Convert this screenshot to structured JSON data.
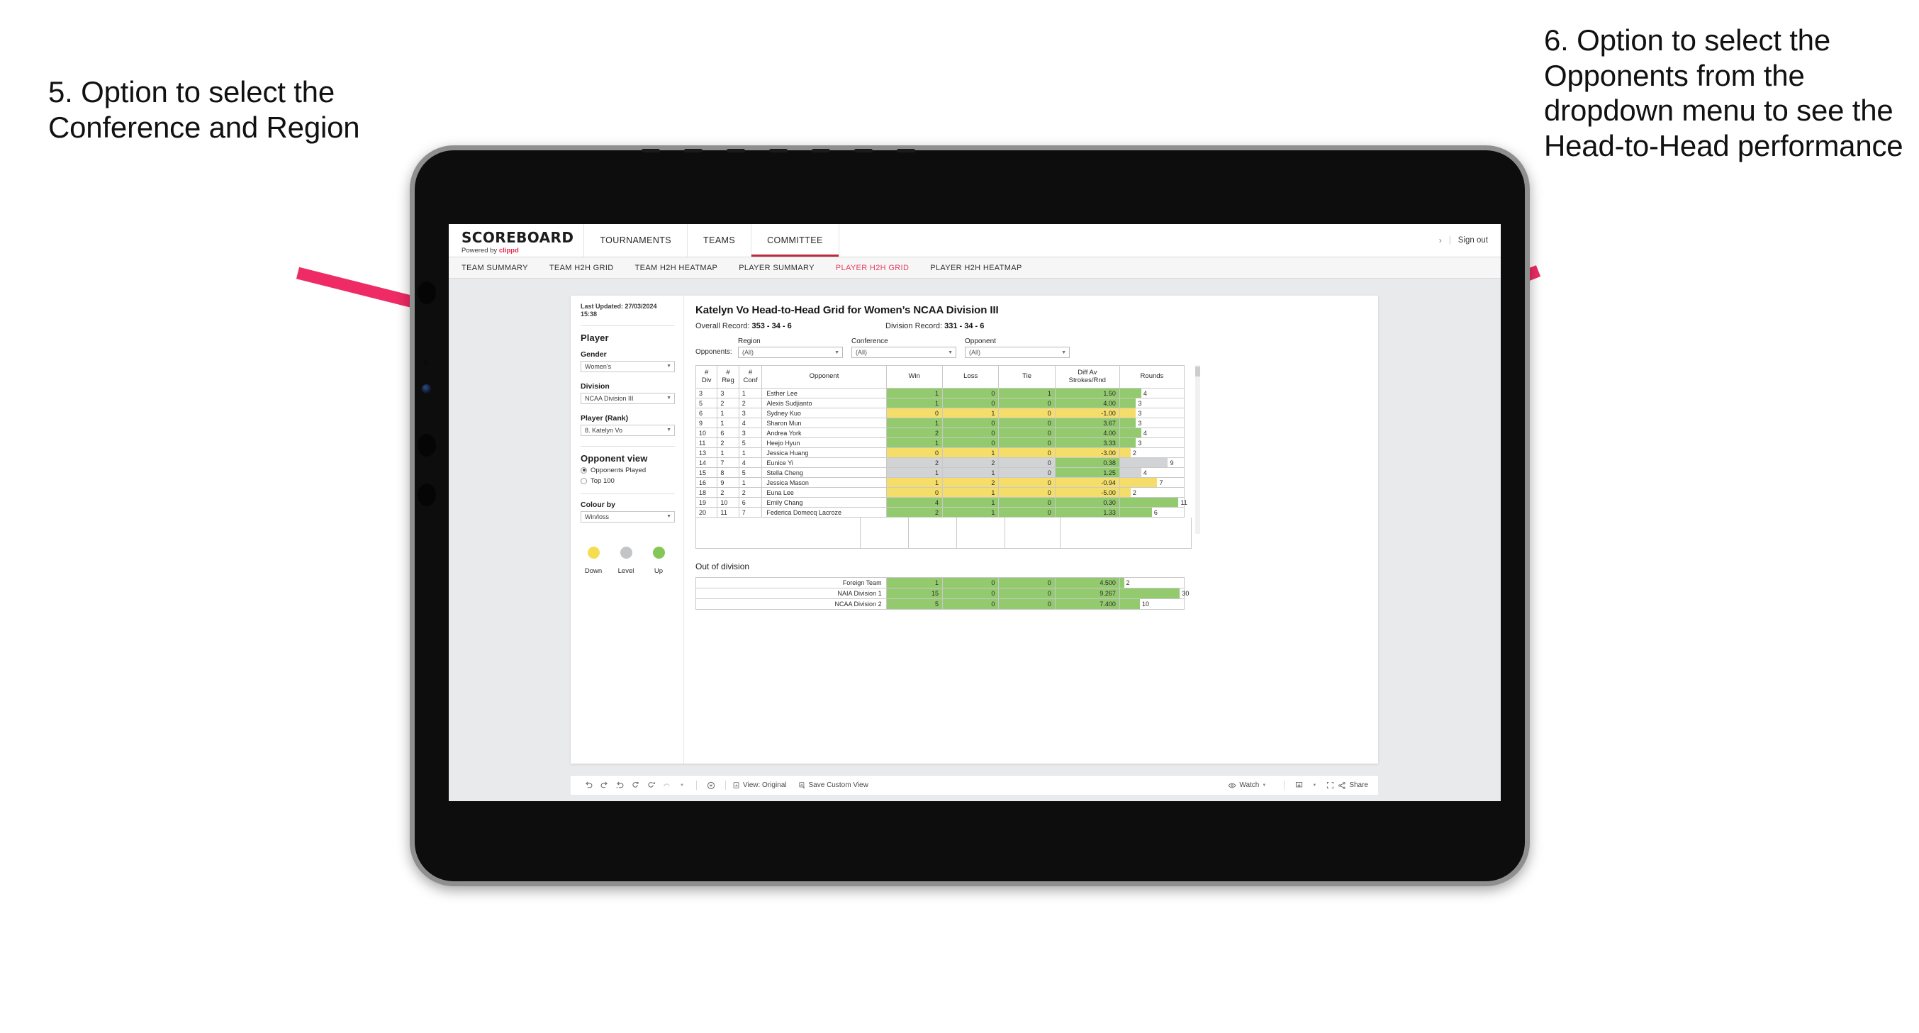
{
  "annotations": {
    "left": "5. Option to select the Conference and Region",
    "right": "6. Option to select the Opponents from the dropdown menu to see the Head-to-Head performance",
    "arrow_color": "#ee2b64"
  },
  "app": {
    "logo": {
      "main": "SCOREBOARD",
      "sub_prefix": "Powered by ",
      "sub_brand": "clippd"
    },
    "top_nav": [
      {
        "label": "TOURNAMENTS",
        "active": false
      },
      {
        "label": "TEAMS",
        "active": false
      },
      {
        "label": "COMMITTEE",
        "active": true
      }
    ],
    "header_right": {
      "chevron": "›",
      "separator": "|",
      "sign_out": "Sign out"
    },
    "sub_nav": [
      {
        "label": "TEAM SUMMARY",
        "active": false
      },
      {
        "label": "TEAM H2H GRID",
        "active": false
      },
      {
        "label": "TEAM H2H HEATMAP",
        "active": false
      },
      {
        "label": "PLAYER SUMMARY",
        "active": false
      },
      {
        "label": "PLAYER H2H GRID",
        "active": true
      },
      {
        "label": "PLAYER H2H HEATMAP",
        "active": false
      }
    ],
    "accent": "#e8405f"
  },
  "sidebar": {
    "last_updated": "Last Updated: 27/03/2024 15:38",
    "section_player": "Player",
    "fields": [
      {
        "label": "Gender",
        "value": "Women’s"
      },
      {
        "label": "Division",
        "value": "NCAA Division III"
      },
      {
        "label": "Player (Rank)",
        "value": "8. Katelyn Vo"
      }
    ],
    "opponent_view": {
      "title": "Opponent view",
      "options": [
        {
          "label": "Opponents Played",
          "selected": true
        },
        {
          "label": "Top 100",
          "selected": false
        }
      ]
    },
    "colour_by": {
      "label": "Colour by",
      "value": "Win/loss"
    },
    "legend": [
      {
        "label": "Down",
        "color": "#f5dd52"
      },
      {
        "label": "Level",
        "color": "#c3c4c6"
      },
      {
        "label": "Up",
        "color": "#84c756"
      }
    ]
  },
  "main": {
    "title": "Katelyn Vo Head-to-Head Grid for Women’s NCAA Division III",
    "overall_record_label": "Overall Record: ",
    "overall_record_value": "353 - 34 - 6",
    "division_record_label": "Division Record: ",
    "division_record_value": "331 - 34 - 6",
    "opponents_label": "Opponents:",
    "filters": [
      {
        "label": "Region",
        "value": "(All)"
      },
      {
        "label": "Conference",
        "value": "(All)"
      },
      {
        "label": "Opponent",
        "value": "(All)"
      }
    ]
  },
  "chart_data": {
    "type": "table",
    "title": "Katelyn Vo Head-to-Head Grid for Women’s NCAA Division III",
    "columns": [
      "# Div",
      "# Reg",
      "# Conf",
      "Opponent",
      "Win",
      "Loss",
      "Tie",
      "Diff Av Strokes/Rnd",
      "Rounds"
    ],
    "rounds_max": 12,
    "colors": {
      "up": "#93ca6e",
      "down": "#f5dd6a",
      "level": "#d2d3d5"
    },
    "rows": [
      {
        "div": "3",
        "reg": "3",
        "conf": "1",
        "opponent": "Esther Lee",
        "win": "1",
        "loss": "0",
        "tie": "1",
        "diff": "1.50",
        "rounds": "4",
        "state": "up"
      },
      {
        "div": "5",
        "reg": "2",
        "conf": "2",
        "opponent": "Alexis Sudjianto",
        "win": "1",
        "loss": "0",
        "tie": "0",
        "diff": "4.00",
        "rounds": "3",
        "state": "up"
      },
      {
        "div": "6",
        "reg": "1",
        "conf": "3",
        "opponent": "Sydney Kuo",
        "win": "0",
        "loss": "1",
        "tie": "0",
        "diff": "-1.00",
        "rounds": "3",
        "state": "down"
      },
      {
        "div": "9",
        "reg": "1",
        "conf": "4",
        "opponent": "Sharon Mun",
        "win": "1",
        "loss": "0",
        "tie": "0",
        "diff": "3.67",
        "rounds": "3",
        "state": "up"
      },
      {
        "div": "10",
        "reg": "6",
        "conf": "3",
        "opponent": "Andrea York",
        "win": "2",
        "loss": "0",
        "tie": "0",
        "diff": "4.00",
        "rounds": "4",
        "state": "up"
      },
      {
        "div": "11",
        "reg": "2",
        "conf": "5",
        "opponent": "Heejo Hyun",
        "win": "1",
        "loss": "0",
        "tie": "0",
        "diff": "3.33",
        "rounds": "3",
        "state": "up"
      },
      {
        "div": "13",
        "reg": "1",
        "conf": "1",
        "opponent": "Jessica Huang",
        "win": "0",
        "loss": "1",
        "tie": "0",
        "diff": "-3.00",
        "rounds": "2",
        "state": "down"
      },
      {
        "div": "14",
        "reg": "7",
        "conf": "4",
        "opponent": "Eunice Yi",
        "win": "2",
        "loss": "2",
        "tie": "0",
        "diff": "0.38",
        "rounds": "9",
        "state": "level",
        "diff_state": "up"
      },
      {
        "div": "15",
        "reg": "8",
        "conf": "5",
        "opponent": "Stella Cheng",
        "win": "1",
        "loss": "1",
        "tie": "0",
        "diff": "1.25",
        "rounds": "4",
        "state": "level",
        "diff_state": "up"
      },
      {
        "div": "16",
        "reg": "9",
        "conf": "1",
        "opponent": "Jessica Mason",
        "win": "1",
        "loss": "2",
        "tie": "0",
        "diff": "-0.94",
        "rounds": "7",
        "state": "down"
      },
      {
        "div": "18",
        "reg": "2",
        "conf": "2",
        "opponent": "Euna Lee",
        "win": "0",
        "loss": "1",
        "tie": "0",
        "diff": "-5.00",
        "rounds": "2",
        "state": "down"
      },
      {
        "div": "19",
        "reg": "10",
        "conf": "6",
        "opponent": "Emily Chang",
        "win": "4",
        "loss": "1",
        "tie": "0",
        "diff": "0.30",
        "rounds": "11",
        "state": "up"
      },
      {
        "div": "20",
        "reg": "11",
        "conf": "7",
        "opponent": "Federica Domecq Lacroze",
        "win": "2",
        "loss": "1",
        "tie": "0",
        "diff": "1.33",
        "rounds": "6",
        "state": "up"
      }
    ]
  },
  "out_of_division": {
    "title": "Out of division",
    "rounds_max": 32,
    "rows": [
      {
        "name": "Foreign Team",
        "win": "1",
        "loss": "0",
        "tie": "0",
        "diff": "4.500",
        "rounds": "2",
        "state": "up"
      },
      {
        "name": "NAIA Division 1",
        "win": "15",
        "loss": "0",
        "tie": "0",
        "diff": "9.267",
        "rounds": "30",
        "state": "up"
      },
      {
        "name": "NCAA Division 2",
        "win": "5",
        "loss": "0",
        "tie": "0",
        "diff": "7.400",
        "rounds": "10",
        "state": "up"
      }
    ]
  },
  "toolbar": {
    "view_label": "View: Original",
    "save_label": "Save Custom View",
    "watch_label": "Watch",
    "share_label": "Share"
  }
}
